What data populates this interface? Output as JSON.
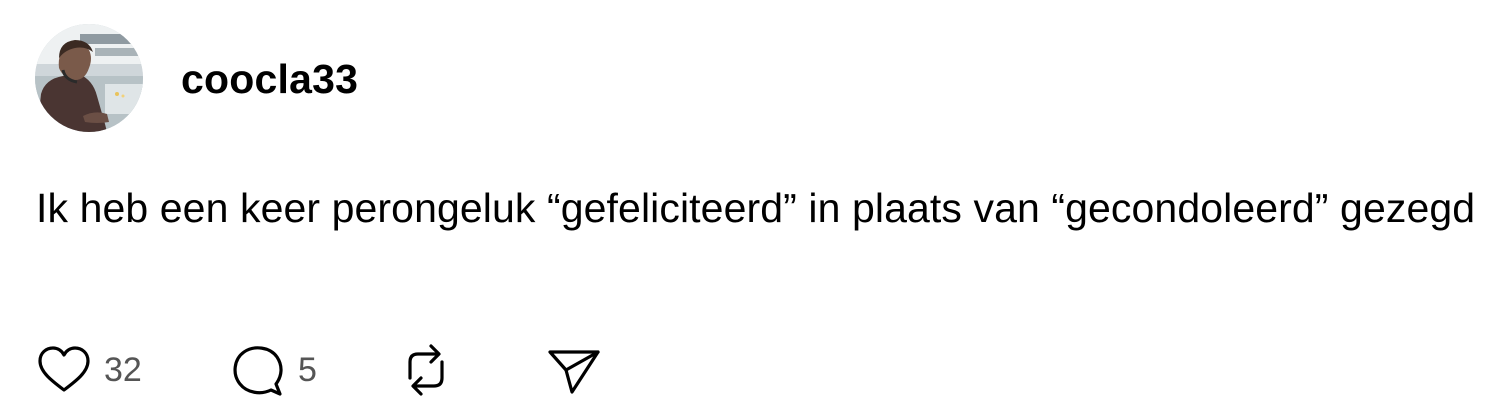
{
  "post": {
    "username": "coocla33",
    "text": "Ik heb een keer perongeluk “gefeliciteerd” in plaats van “gecondoleerd” gezegd",
    "avatar_icon": "user-avatar-photo"
  },
  "actions": {
    "like": {
      "icon": "heart-icon",
      "count": "32"
    },
    "reply": {
      "icon": "speech-bubble-icon",
      "count": "5"
    },
    "repost": {
      "icon": "repost-icon"
    },
    "share": {
      "icon": "send-icon"
    }
  },
  "colors": {
    "text": "#000000",
    "muted": "#555555",
    "icon": "#000000",
    "background": "#ffffff"
  }
}
